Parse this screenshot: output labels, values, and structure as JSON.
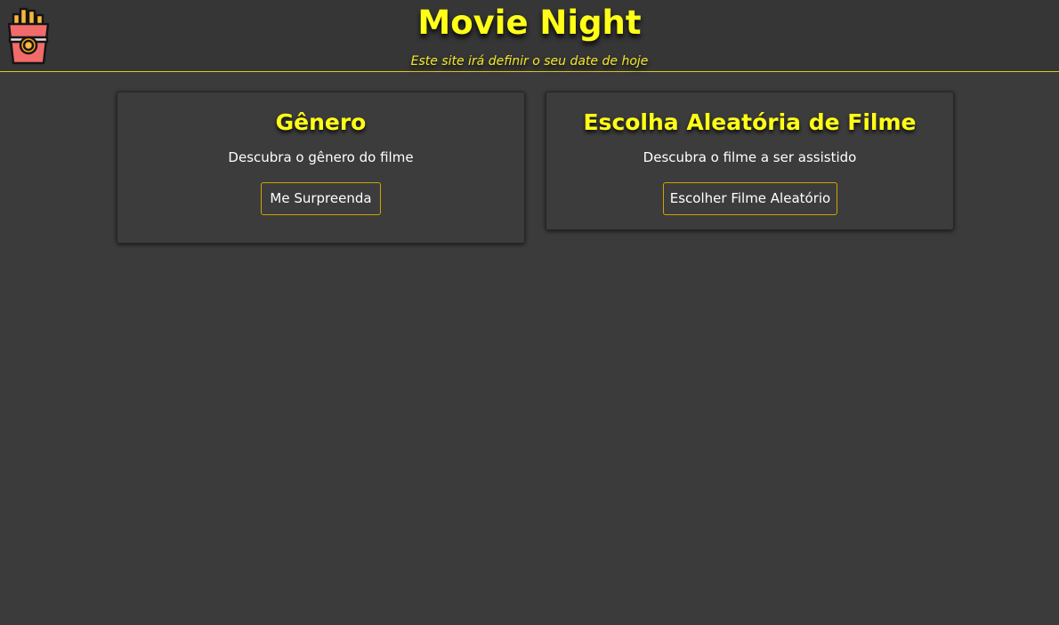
{
  "header": {
    "title": "Movie Night",
    "subtitle": "Este site irá definir o seu date de hoje"
  },
  "cards": [
    {
      "title": "Gênero",
      "description": "Descubra o gênero do filme",
      "button_label": "Me Surpreenda"
    },
    {
      "title": "Escolha Aleatória de Filme",
      "description": "Descubra o filme a ser assistido",
      "button_label": "Escolher Filme Aleatório"
    }
  ],
  "colors": {
    "background": "#3b3b3b",
    "accent_yellow": "#ffff17",
    "button_border": "#cfa400",
    "text": "#ffffff"
  },
  "icons": {
    "logo": "french-fries-icon"
  }
}
